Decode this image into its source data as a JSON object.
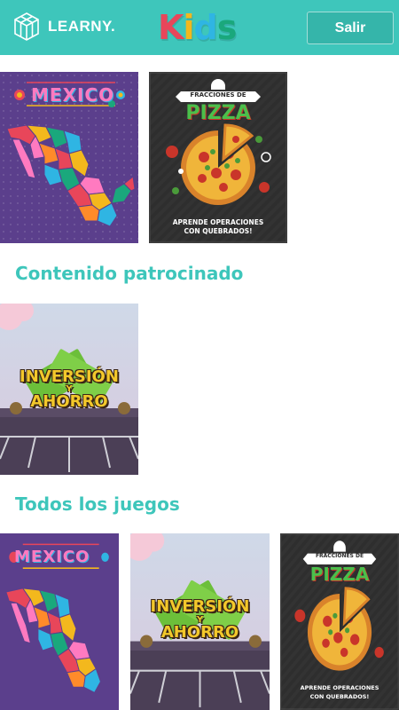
{
  "header": {
    "brand": "LEARNY.",
    "kids_letters": [
      "K",
      "i",
      "d",
      "s"
    ],
    "kids_colors": [
      "#e8465a",
      "#f3b81d",
      "#2fb5e3",
      "#1aa87c"
    ],
    "exit_label": "Salir",
    "bg_color": "#3ec6bb"
  },
  "sections": {
    "sponsored_title": "Contenido patrocinado",
    "all_games_title": "Todos los juegos"
  },
  "games": {
    "mexico": {
      "title": "MEXICO"
    },
    "pizza": {
      "top_label": "FRACCIONES DE",
      "title": "PIZZA",
      "subtitle_line1": "APRENDE OPERACIONES",
      "subtitle_line2": "CON QUEBRADOS!"
    },
    "inversion": {
      "line1": "INVERSIÓN",
      "line2": "Y",
      "line3": "AHORRO"
    }
  }
}
